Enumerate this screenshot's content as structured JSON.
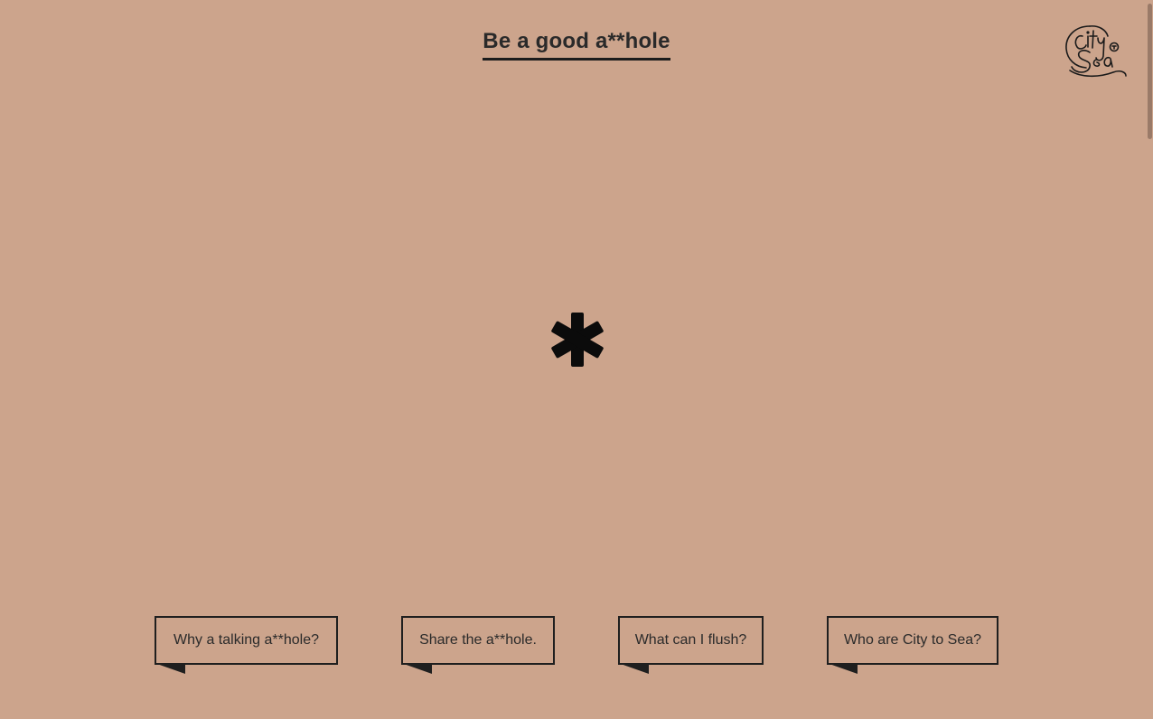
{
  "header": {
    "title": "Be a good a**hole"
  },
  "logo": {
    "icon": "city-to-sea-logo-icon"
  },
  "hero": {
    "icon": "asterisk-icon"
  },
  "nav": {
    "buttons": [
      {
        "label": "Why a talking a**hole?"
      },
      {
        "label": "Share the a**hole."
      },
      {
        "label": "What can I flush?"
      },
      {
        "label": "Who are City to Sea?"
      }
    ]
  },
  "colors": {
    "background": "#cca48c",
    "ink": "#1f1f1f"
  }
}
